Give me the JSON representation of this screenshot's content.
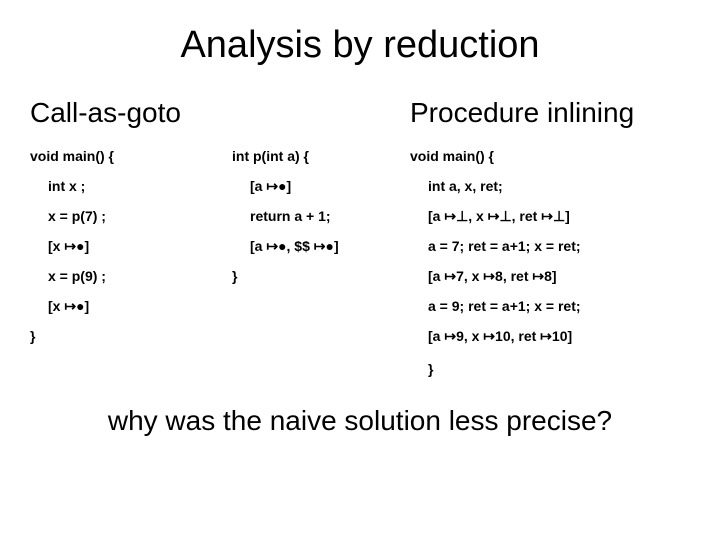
{
  "title": "Analysis by reduction",
  "left": {
    "heading": "Call-as-goto",
    "lines": [
      {
        "text": "void main() {",
        "indent": 0
      },
      {
        "text": "int x ;",
        "indent": 1
      },
      {
        "text": "x = p(7) ;",
        "indent": 1
      },
      {
        "text": "[x ↦●]",
        "indent": 1
      },
      {
        "text": "x = p(9) ;",
        "indent": 1
      },
      {
        "text": "[x ↦●]",
        "indent": 1
      },
      {
        "text": "}",
        "indent": 0
      }
    ]
  },
  "mid": {
    "lines": [
      {
        "text": "int p(int a) {",
        "indent": 0
      },
      {
        "text": "[a ↦●]",
        "indent": 1
      },
      {
        "text": "return a + 1;",
        "indent": 1
      },
      {
        "text": "[a ↦●, $$ ↦●]",
        "indent": 1
      },
      {
        "text": "}",
        "indent": 0
      }
    ]
  },
  "right": {
    "heading": "Procedure inlining",
    "lines": [
      {
        "text": "void main() {",
        "indent": 0
      },
      {
        "text": "int a, x, ret;",
        "indent": 1
      },
      {
        "text": "[a ↦⊥, x ↦⊥, ret ↦⊥]",
        "indent": 1
      },
      {
        "text": "a = 7; ret = a+1; x = ret;",
        "indent": 1
      },
      {
        "text": "[a ↦7, x ↦8, ret ↦8]",
        "indent": 1
      },
      {
        "text": "a = 9; ret = a+1; x = ret;",
        "indent": 1
      },
      {
        "text": "[a ↦9, x ↦10, ret ↦10]",
        "indent": 1
      }
    ],
    "closing_brace": "}"
  },
  "question": "why was the naive solution less precise?"
}
